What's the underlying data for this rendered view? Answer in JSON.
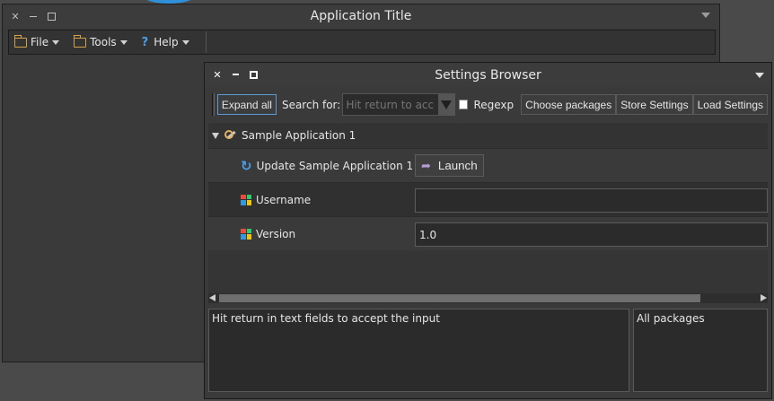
{
  "main_window": {
    "title": "Application Title",
    "menu": [
      {
        "label": "File",
        "icon": "folder-icon"
      },
      {
        "label": "Tools",
        "icon": "folder-icon"
      },
      {
        "label": "Help",
        "icon": "help-icon"
      }
    ]
  },
  "settings_window": {
    "title": "Settings Browser",
    "toolbar": {
      "expand_all": "Expand all",
      "search_label": "Search for:",
      "search_placeholder": "Hit return to accept",
      "regexp_label": "Regexp",
      "choose_packages": "Choose packages",
      "store_settings": "Store Settings",
      "load_settings": "Load Settings"
    },
    "tree": {
      "group_label": "Sample Application 1",
      "update_label": "Update Sample Application 1",
      "launch_label": "Launch",
      "username_label": "Username",
      "username_value": "",
      "version_label": "Version",
      "version_value": "1.0"
    },
    "help_text": "Hit return in text fields to accept the input",
    "packages_text": "All packages"
  }
}
